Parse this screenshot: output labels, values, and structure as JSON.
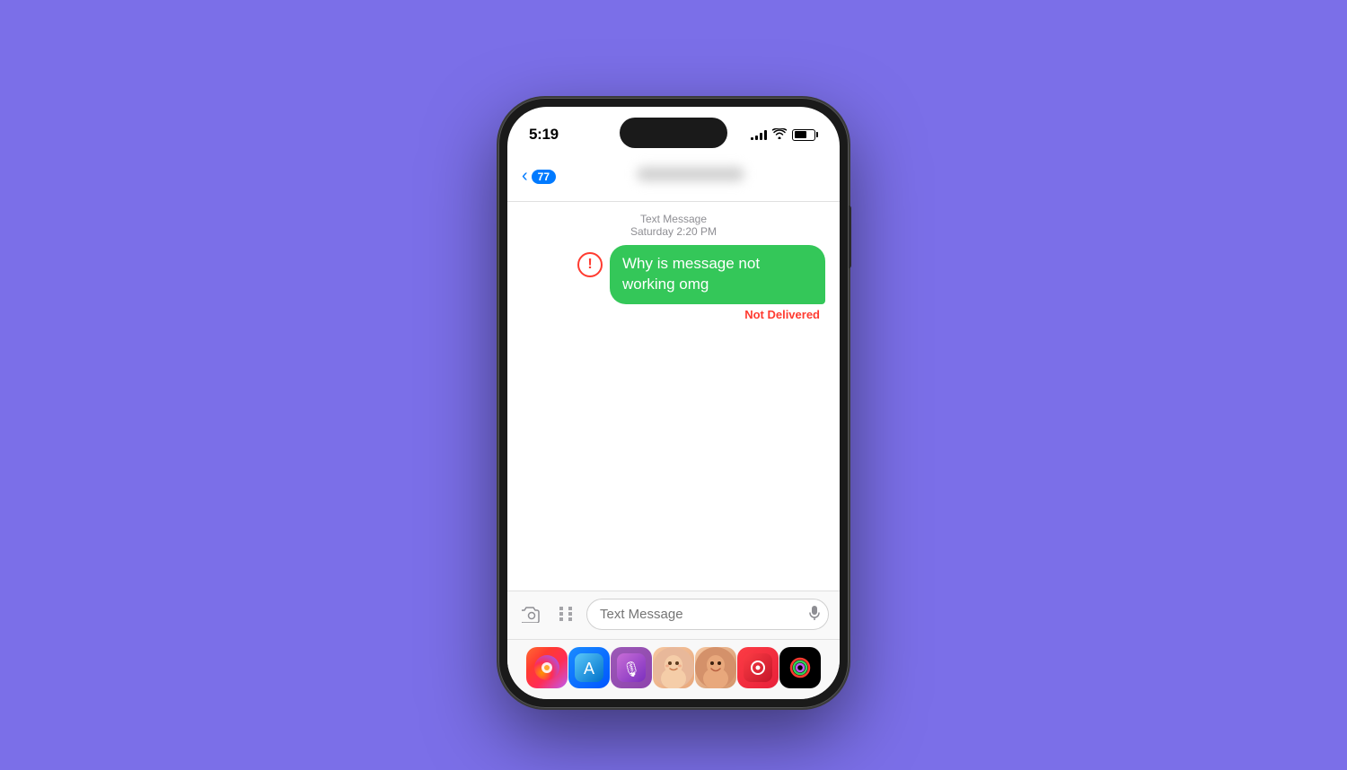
{
  "background_color": "#7B6FE8",
  "phone": {
    "status_bar": {
      "time": "5:19",
      "signal_bars": [
        3,
        6,
        9,
        12
      ],
      "battery_percent": "61"
    },
    "nav_bar": {
      "back_label": "77",
      "contact_name": "Contact Name"
    },
    "messages": [
      {
        "timestamp_label": "Text Message",
        "timestamp_date": "Saturday 2:20 PM",
        "bubble_text": "Why is message not working omg",
        "status": "Not Delivered",
        "sent_by_user": true,
        "error": true
      }
    ],
    "input_bar": {
      "placeholder": "Text Message"
    },
    "dock": {
      "apps": [
        {
          "name": "Photos",
          "class": "photos",
          "icon": "🌅"
        },
        {
          "name": "App Store",
          "class": "appstore",
          "icon": "🅐"
        },
        {
          "name": "Podcasts",
          "class": "podcasts",
          "icon": "🎙"
        },
        {
          "name": "Memoji 1",
          "class": "memoji1",
          "icon": "😊"
        },
        {
          "name": "Memoji 2",
          "class": "memoji2",
          "icon": "😄"
        },
        {
          "name": "Music",
          "class": "music",
          "icon": "🎵"
        },
        {
          "name": "Activity",
          "class": "activity",
          "icon": "◎"
        }
      ]
    }
  }
}
